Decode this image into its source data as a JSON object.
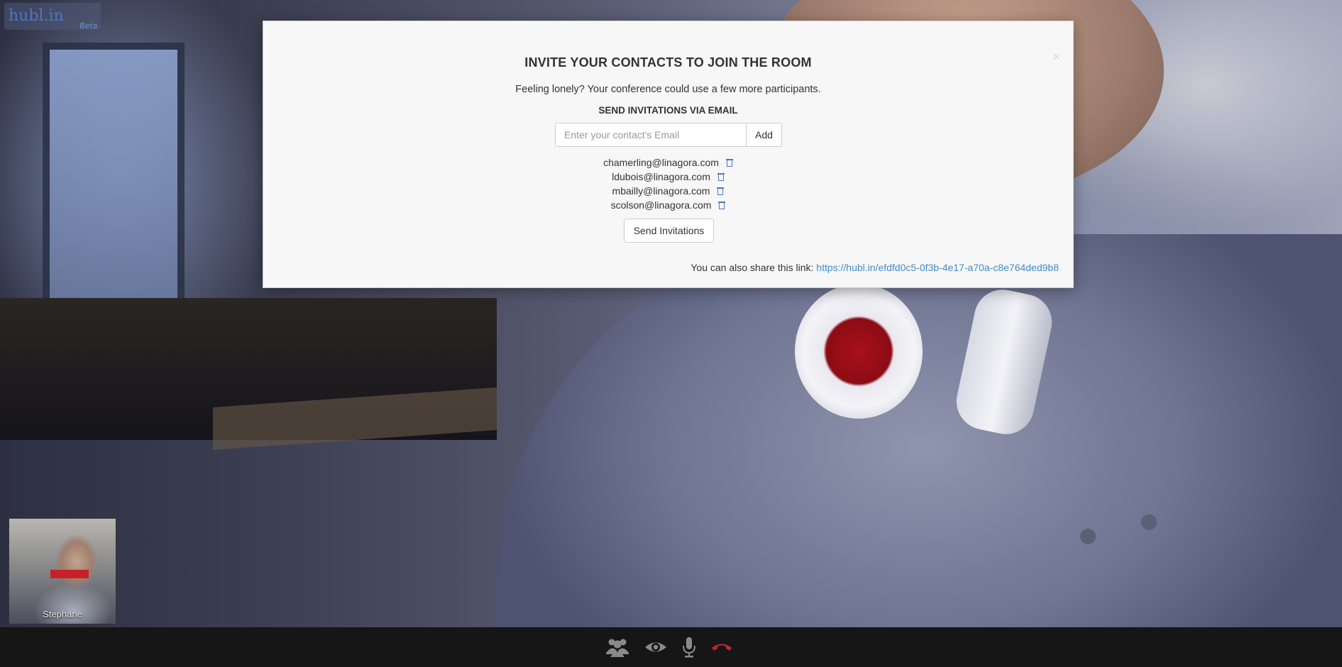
{
  "app": {
    "logo_text": "hubl.in",
    "logo_badge": "Beta"
  },
  "invite_modal": {
    "close_label": "×",
    "title": "INVITE YOUR CONTACTS TO JOIN THE ROOM",
    "subtitle": "Feeling lonely? Your conference could use a few more participants.",
    "email_section_title": "SEND INVITATIONS VIA EMAIL",
    "email_input": {
      "placeholder": "Enter your contact's Email",
      "value": ""
    },
    "add_label": "Add",
    "emails": [
      "chamerling@linagora.com",
      "ldubois@linagora.com",
      "mbailly@linagora.com",
      "scolson@linagora.com"
    ],
    "send_label": "Send Invitations",
    "share_text": "You can also share this link:",
    "share_link": "https://hubl.in/efdfd0c5-0f3b-4e17-a70a-c8e764ded9b8"
  },
  "self_view": {
    "name": "Stephane"
  },
  "toolbar": {
    "buttons": [
      "users-icon",
      "eye-icon",
      "microphone-icon",
      "hangup-icon"
    ],
    "colors": {
      "icon": "#8a8a8a",
      "hangup": "#c0262d"
    }
  }
}
